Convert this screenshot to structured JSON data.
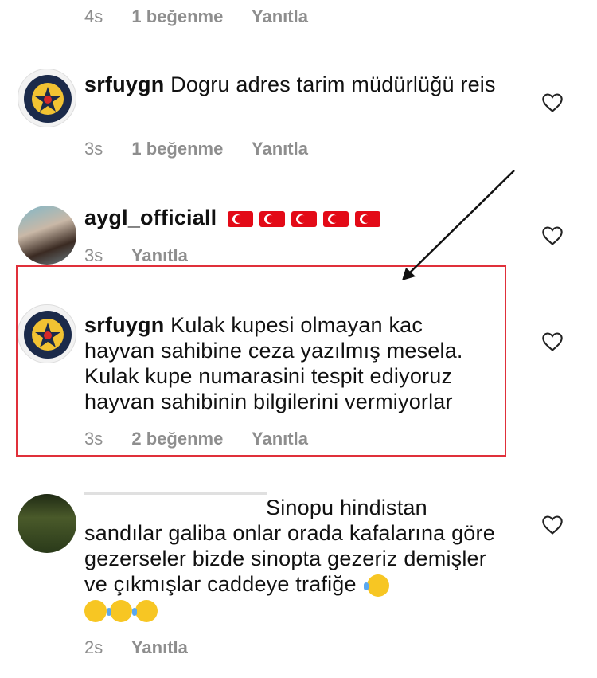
{
  "top_meta": {
    "time": "4s",
    "likes": "1 beğenme",
    "reply": "Yanıtla"
  },
  "comments": [
    {
      "username": "srfuygn",
      "text": "Dogru adres tarim müdürlüğü reis",
      "time": "3s",
      "likes": "1 beğenme",
      "reply": "Yanıtla",
      "avatar": "police-emblem"
    },
    {
      "username": "aygl_officiall",
      "text": "",
      "flags": [
        "🇹🇷",
        "🇹🇷",
        "🇹🇷",
        "🇹🇷",
        "🇹🇷"
      ],
      "time": "3s",
      "reply": "Yanıtla",
      "avatar": "profile-photo"
    },
    {
      "username": "srfuygn",
      "text": "Kulak kupesi olmayan kac hayvan sahibine ceza yazılmış mesela. Kulak kupe numarasini tespit ediyoruz hayvan sahibinin bilgilerini vermiyorlar",
      "time": "3s",
      "likes": "2 beğenme",
      "reply": "Yanıtla",
      "avatar": "police-emblem"
    },
    {
      "username": "",
      "text": "Sinopu hindistan sandılar galiba onlar orada kafalarına göre  gezerseler bizde sinopta gezeriz demişler ve çıkmışlar caddeye trafiğe",
      "emojis": [
        "😂",
        "😀",
        "😂",
        "😂"
      ],
      "time": "2s",
      "reply": "Yanıtla",
      "avatar": "profile-photo"
    }
  ],
  "colors": {
    "highlight": "#e0303a",
    "meta": "#8e8e8e"
  },
  "icons": {
    "like": "heart-outline-icon"
  }
}
